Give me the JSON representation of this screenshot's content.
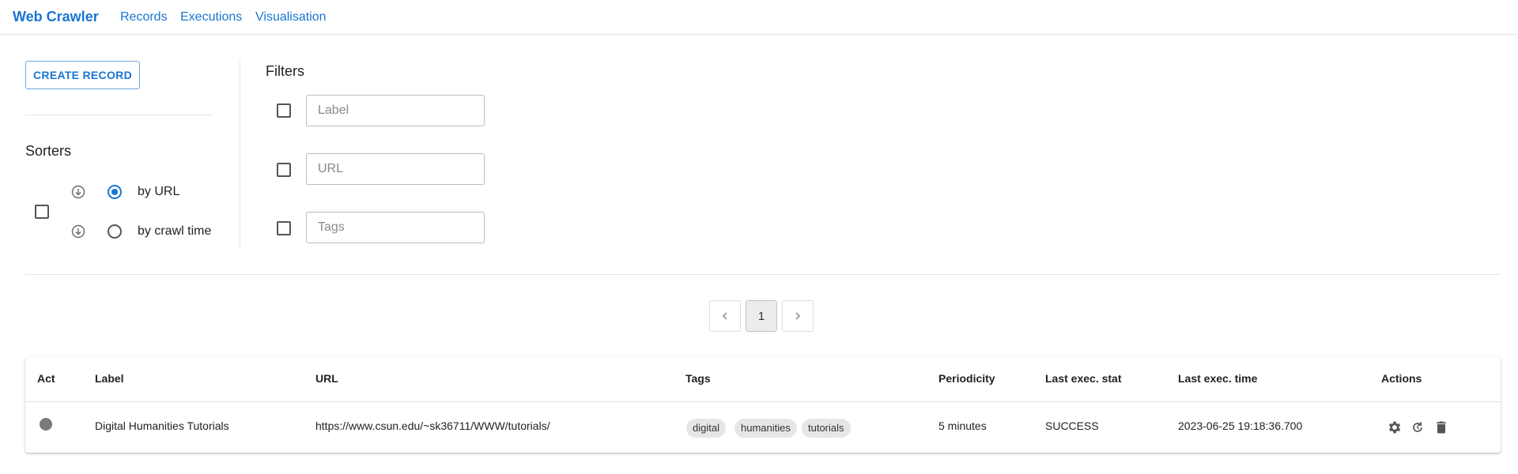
{
  "app": {
    "title": "Web Crawler",
    "nav": [
      "Records",
      "Executions",
      "Visualisation"
    ]
  },
  "controls": {
    "create_label": "CREATE RECORD",
    "sorters_title": "Sorters",
    "sort_options": [
      {
        "label": "by URL",
        "selected": true
      },
      {
        "label": "by crawl time",
        "selected": false
      }
    ],
    "filters_title": "Filters",
    "filters": [
      {
        "placeholder": "Label",
        "value": ""
      },
      {
        "placeholder": "URL",
        "value": ""
      },
      {
        "placeholder": "Tags",
        "value": ""
      }
    ]
  },
  "pagination": {
    "current_page": "1"
  },
  "table": {
    "columns": [
      "Act",
      "Label",
      "URL",
      "Tags",
      "Periodicity",
      "Last exec. stat",
      "Last exec. time",
      "Actions"
    ],
    "rows": [
      {
        "label": "Digital Humanities Tutorials",
        "url": "https://www.csun.edu/~sk36711/WWW/tutorials/",
        "tags": [
          "digital",
          "humanities",
          "tutorials"
        ],
        "periodicity": "5 minutes",
        "last_status": "SUCCESS",
        "last_time": "2023-06-25 19:18:36.700",
        "actions": [
          "gear-icon",
          "refresh-icon",
          "trash-icon"
        ]
      }
    ]
  },
  "colors": {
    "accent": "#1976d2",
    "inactive_dot": "#7a7a7a"
  }
}
